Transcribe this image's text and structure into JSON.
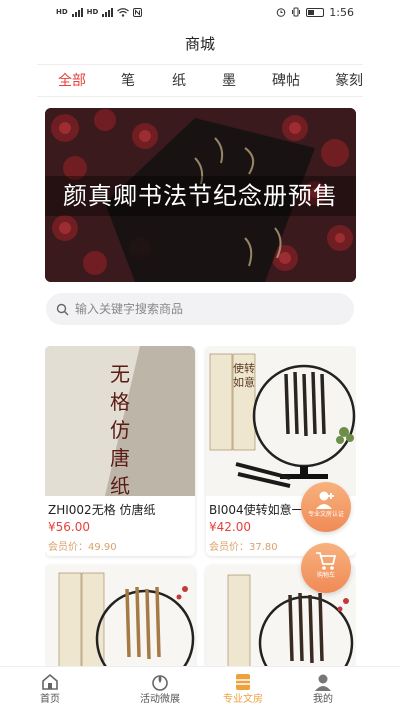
{
  "status_bar": {
    "time": "1:56"
  },
  "header": {
    "title": "商城"
  },
  "categories": [
    "全部",
    "笔",
    "纸",
    "墨",
    "碑帖",
    "篆刻"
  ],
  "banner": {
    "title": "颜真卿书法节纪念册预售"
  },
  "search": {
    "placeholder": "输入关键字搜索商品"
  },
  "products": [
    {
      "name": "ZHI002无格 仿唐纸",
      "price": "¥56.00",
      "member_price": "会员价：49.90",
      "image_text": "无格仿唐纸"
    },
    {
      "name": "BI004使转如意一",
      "price": "¥42.00",
      "member_price": "会员价：37.80",
      "image_text": "使转如意"
    },
    {
      "name": "",
      "price": "",
      "member_price": "",
      "image_text": ""
    },
    {
      "name": "",
      "price": "",
      "member_price": "",
      "image_text": ""
    }
  ],
  "floating": {
    "upload_label": "专业文房认证",
    "cart_label": "购物车"
  },
  "bottom_nav": [
    {
      "label": "首页",
      "icon": "home-icon"
    },
    {
      "label": "活动微展",
      "icon": "activity-icon"
    },
    {
      "label": "专业文房",
      "icon": "shop-icon"
    },
    {
      "label": "我的",
      "icon": "user-icon"
    }
  ],
  "colors": {
    "accent": "#e8403c",
    "nav_active": "#f0a13c",
    "member_price": "#d9a26a",
    "fab": "#f08a56"
  }
}
